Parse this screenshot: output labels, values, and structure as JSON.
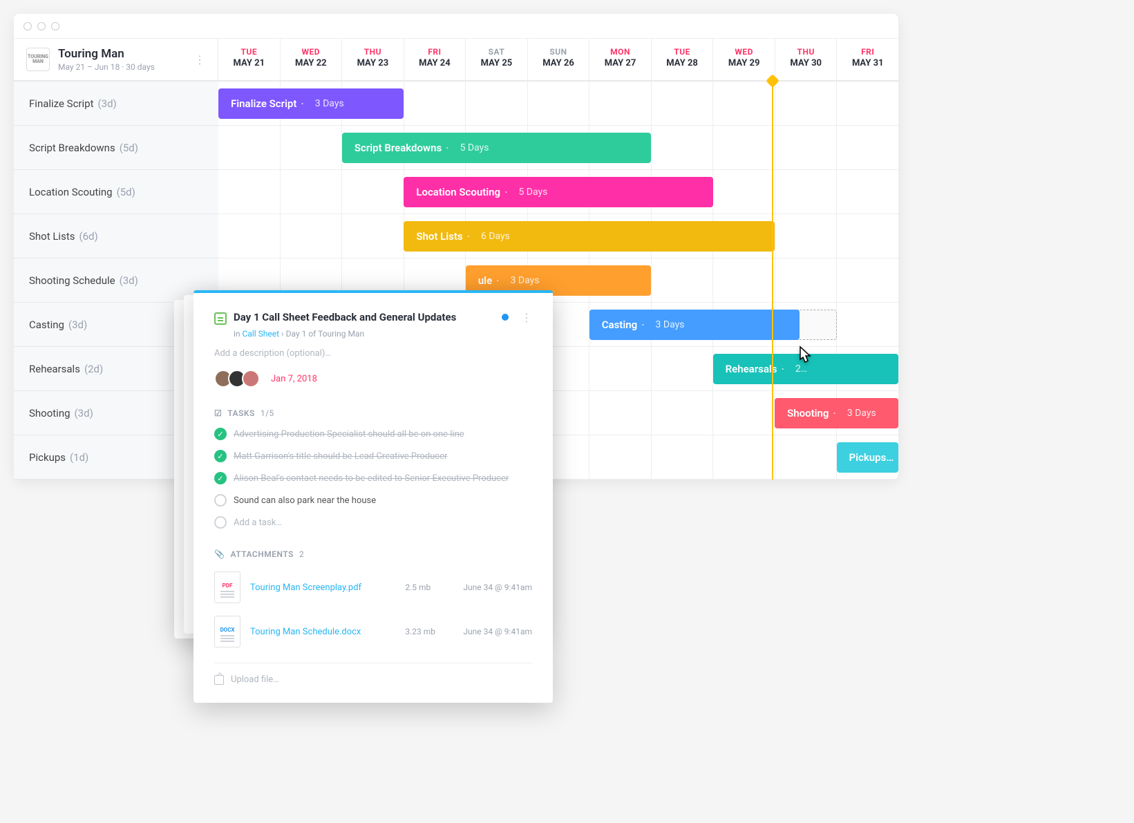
{
  "project": {
    "title": "Touring Man",
    "meta": "May 21 – Jun 18  ·  30 days",
    "logo_text": "TOURING\nMAN"
  },
  "days": [
    {
      "name": "TUE",
      "date": "MAY 21",
      "weekend": false
    },
    {
      "name": "WED",
      "date": "MAY 22",
      "weekend": false
    },
    {
      "name": "THU",
      "date": "MAY 23",
      "weekend": false
    },
    {
      "name": "FRI",
      "date": "MAY 24",
      "weekend": false
    },
    {
      "name": "SAT",
      "date": "MAY 25",
      "weekend": true
    },
    {
      "name": "SUN",
      "date": "MAY 26",
      "weekend": true
    },
    {
      "name": "MON",
      "date": "MAY 27",
      "weekend": false
    },
    {
      "name": "TUE",
      "date": "MAY 28",
      "weekend": false
    },
    {
      "name": "WED",
      "date": "MAY 29",
      "weekend": false
    },
    {
      "name": "THU",
      "date": "MAY 30",
      "weekend": false
    },
    {
      "name": "FRI",
      "date": "MAY 31",
      "weekend": false
    }
  ],
  "today_column_index": 8.95,
  "tasks": [
    {
      "label": "Finalize Script",
      "dur_label": "(3d)",
      "bar_label": "Finalize Script",
      "bar_dur": "3 Days",
      "start": 0,
      "span": 3,
      "color": "#7e57ff"
    },
    {
      "label": "Script Breakdowns",
      "dur_label": "(5d)",
      "bar_label": "Script Breakdowns",
      "bar_dur": "5 Days",
      "start": 2,
      "span": 5,
      "color": "#2ecc9b"
    },
    {
      "label": "Location Scouting",
      "dur_label": "(5d)",
      "bar_label": "Location Scouting",
      "bar_dur": "5 Days",
      "start": 3,
      "span": 5,
      "color": "#ff2fa8"
    },
    {
      "label": "Shot Lists",
      "dur_label": "(6d)",
      "bar_label": "Shot Lists",
      "bar_dur": "6 Days",
      "start": 3,
      "span": 6,
      "color": "#f2b90f"
    },
    {
      "label": "Shooting Schedule",
      "dur_label": "(3d)",
      "bar_label": "Shooting Schedule",
      "bar_dur": "3 Days",
      "start": 4,
      "span": 3,
      "color": "#ff9f2e",
      "truncated": "ule"
    },
    {
      "label": "Casting",
      "dur_label": "(3d)",
      "bar_label": "Casting",
      "bar_dur": "3 Days",
      "start": 6,
      "span": 3.4,
      "color": "#459dff",
      "ghost_start": 6,
      "ghost_span": 4
    },
    {
      "label": "Rehearsals",
      "dur_label": "(2d)",
      "bar_label": "Rehearsals",
      "bar_dur": "2…",
      "start": 8,
      "span": 3,
      "color": "#18c2b8"
    },
    {
      "label": "Shooting",
      "dur_label": "(3d)",
      "bar_label": "Shooting",
      "bar_dur": "3 Days",
      "start": 9,
      "span": 2,
      "color": "#ff5a6e"
    },
    {
      "label": "Pickups",
      "dur_label": "(1d)",
      "bar_label": "Pickups…",
      "bar_dur": "",
      "start": 10,
      "span": 1,
      "color": "#3dd0e0"
    }
  ],
  "card": {
    "title": "Day 1 Call Sheet Feedback and General Updates",
    "breadcrumb_prefix": "in ",
    "breadcrumb_link1": "Call Sheet",
    "breadcrumb_sep": "  ›  ",
    "breadcrumb_link2": "Day 1 of Touring Man",
    "description_placeholder": "Add a description (optional)…",
    "due_date": "Jan 7, 2018",
    "avatars": [
      {
        "bg": "#8e6e5a"
      },
      {
        "bg": "#333"
      },
      {
        "bg": "#c77"
      }
    ],
    "tasks_label": "TASKS",
    "tasks_count": "1/5",
    "items": [
      {
        "done": true,
        "text": "Advertising Production Specialist should all be on one line"
      },
      {
        "done": true,
        "text": "Matt Garrison's title should be Lead Creative Producer"
      },
      {
        "done": true,
        "text": "Alison Beal's contact needs to be edited to Senior Executive Producer"
      },
      {
        "done": false,
        "text": "Sound can also park near the house"
      }
    ],
    "add_task_placeholder": "Add a task…",
    "attachments_label": "ATTACHMENTS",
    "attachments_count": "2",
    "attachments": [
      {
        "type": "PDF",
        "name": "Touring Man Screenplay.pdf",
        "size": "2.5 mb",
        "date": "June 34 @ 9:41am"
      },
      {
        "type": "DOCX",
        "name": "Touring Man Schedule.docx",
        "size": "3.23 mb",
        "date": "June 34 @ 9:41am"
      }
    ],
    "upload_placeholder": "Upload file…"
  }
}
